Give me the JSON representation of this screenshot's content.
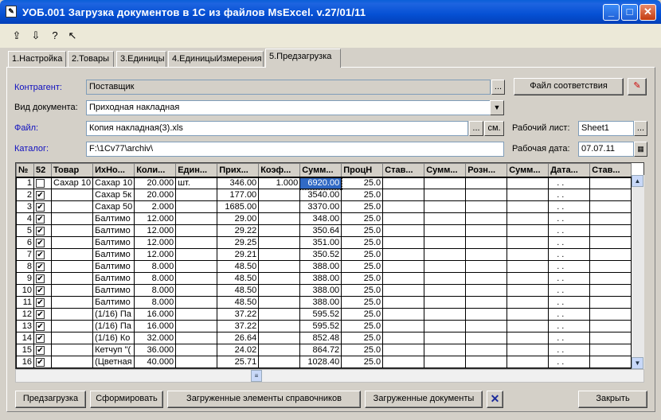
{
  "window": {
    "title": "УОБ.001 Загрузка документов в 1С из файлов MsExcel. v.27/01/11"
  },
  "tabs": [
    {
      "label": "1.Настройка"
    },
    {
      "label": "2.Товары"
    },
    {
      "label": "3.Единицы"
    },
    {
      "label": "4.ЕдиницыИзмерения"
    },
    {
      "label": "5.Предзагрузка"
    }
  ],
  "form": {
    "kontragent_label": "Контрагент:",
    "kontragent_value": "Поставщик",
    "vid_label": "Вид документа:",
    "vid_value": "Приходная накладная",
    "file_label": "Файл:",
    "file_value": "Копия накладная(3).xls",
    "file_sm": "см.",
    "katalog_label": "Каталог:",
    "katalog_value": "F:\\1Cv77\\archiv\\",
    "match_button": "Файл соответствия",
    "sheet_label": "Рабочий лист:",
    "sheet_value": "Sheet1",
    "date_label": "Рабочая дата:",
    "date_value": "07.07.11",
    "ellipsis": "..."
  },
  "table": {
    "columns": [
      "№",
      "52",
      "Товар",
      "ИхНо...",
      "Коли...",
      "Един...",
      "Прих...",
      "Коэф...",
      "Сумм...",
      "ПроцН",
      "Став...",
      "Сумм...",
      "Розн...",
      "Сумм...",
      "Дата...",
      "Став..."
    ],
    "rows": [
      {
        "n": "1",
        "checked": false,
        "tovar": "Сахар 10",
        "name": "Сахар 10",
        "qty": "20.000",
        "unit": "шт.",
        "price": "346.00",
        "coef": "1.000",
        "sum": "6920.00",
        "proc": "25.0",
        "date": ". ."
      },
      {
        "n": "2",
        "checked": true,
        "tovar": "",
        "name": "Сахар  5к",
        "qty": "20.000",
        "unit": "",
        "price": "177.00",
        "coef": "",
        "sum": "3540.00",
        "proc": "25.0",
        "date": ". ."
      },
      {
        "n": "3",
        "checked": true,
        "tovar": "",
        "name": "Сахар 50",
        "qty": "2.000",
        "unit": "",
        "price": "1685.00",
        "coef": "",
        "sum": "3370.00",
        "proc": "25.0",
        "date": ". ."
      },
      {
        "n": "4",
        "checked": true,
        "tovar": "",
        "name": "Балтимо",
        "qty": "12.000",
        "unit": "",
        "price": "29.00",
        "coef": "",
        "sum": "348.00",
        "proc": "25.0",
        "date": ". ."
      },
      {
        "n": "5",
        "checked": true,
        "tovar": "",
        "name": "Балтимо",
        "qty": "12.000",
        "unit": "",
        "price": "29.22",
        "coef": "",
        "sum": "350.64",
        "proc": "25.0",
        "date": ". ."
      },
      {
        "n": "6",
        "checked": true,
        "tovar": "",
        "name": "Балтимо",
        "qty": "12.000",
        "unit": "",
        "price": "29.25",
        "coef": "",
        "sum": "351.00",
        "proc": "25.0",
        "date": ". ."
      },
      {
        "n": "7",
        "checked": true,
        "tovar": "",
        "name": "Балтимо",
        "qty": "12.000",
        "unit": "",
        "price": "29.21",
        "coef": "",
        "sum": "350.52",
        "proc": "25.0",
        "date": ". ."
      },
      {
        "n": "8",
        "checked": true,
        "tovar": "",
        "name": "Балтимо",
        "qty": "8.000",
        "unit": "",
        "price": "48.50",
        "coef": "",
        "sum": "388.00",
        "proc": "25.0",
        "date": ". ."
      },
      {
        "n": "9",
        "checked": true,
        "tovar": "",
        "name": "Балтимо",
        "qty": "8.000",
        "unit": "",
        "price": "48.50",
        "coef": "",
        "sum": "388.00",
        "proc": "25.0",
        "date": ". ."
      },
      {
        "n": "10",
        "checked": true,
        "tovar": "",
        "name": "Балтимо",
        "qty": "8.000",
        "unit": "",
        "price": "48.50",
        "coef": "",
        "sum": "388.00",
        "proc": "25.0",
        "date": ". ."
      },
      {
        "n": "11",
        "checked": true,
        "tovar": "",
        "name": "Балтимо",
        "qty": "8.000",
        "unit": "",
        "price": "48.50",
        "coef": "",
        "sum": "388.00",
        "proc": "25.0",
        "date": ". ."
      },
      {
        "n": "12",
        "checked": true,
        "tovar": "",
        "name": "(1/16) Па",
        "qty": "16.000",
        "unit": "",
        "price": "37.22",
        "coef": "",
        "sum": "595.52",
        "proc": "25.0",
        "date": ". ."
      },
      {
        "n": "13",
        "checked": true,
        "tovar": "",
        "name": "(1/16) Па",
        "qty": "16.000",
        "unit": "",
        "price": "37.22",
        "coef": "",
        "sum": "595.52",
        "proc": "25.0",
        "date": ". ."
      },
      {
        "n": "14",
        "checked": true,
        "tovar": "",
        "name": "(1/16) Ко",
        "qty": "32.000",
        "unit": "",
        "price": "26.64",
        "coef": "",
        "sum": "852.48",
        "proc": "25.0",
        "date": ". ."
      },
      {
        "n": "15",
        "checked": true,
        "tovar": "",
        "name": "Кетчуп \"(",
        "qty": "36.000",
        "unit": "",
        "price": "24.02",
        "coef": "",
        "sum": "864.72",
        "proc": "25.0",
        "date": ". ."
      },
      {
        "n": "16",
        "checked": true,
        "tovar": "",
        "name": "(Цветная",
        "qty": "40.000",
        "unit": "",
        "price": "25.71",
        "coef": "",
        "sum": "1028.40",
        "proc": "25.0",
        "date": ". ."
      }
    ]
  },
  "buttons": {
    "predload": "Предзагрузка",
    "form": "Сформировать",
    "loaded_refs": "Загруженные элементы справочников",
    "loaded_docs": "Загруженные документы",
    "close": "Закрыть"
  }
}
